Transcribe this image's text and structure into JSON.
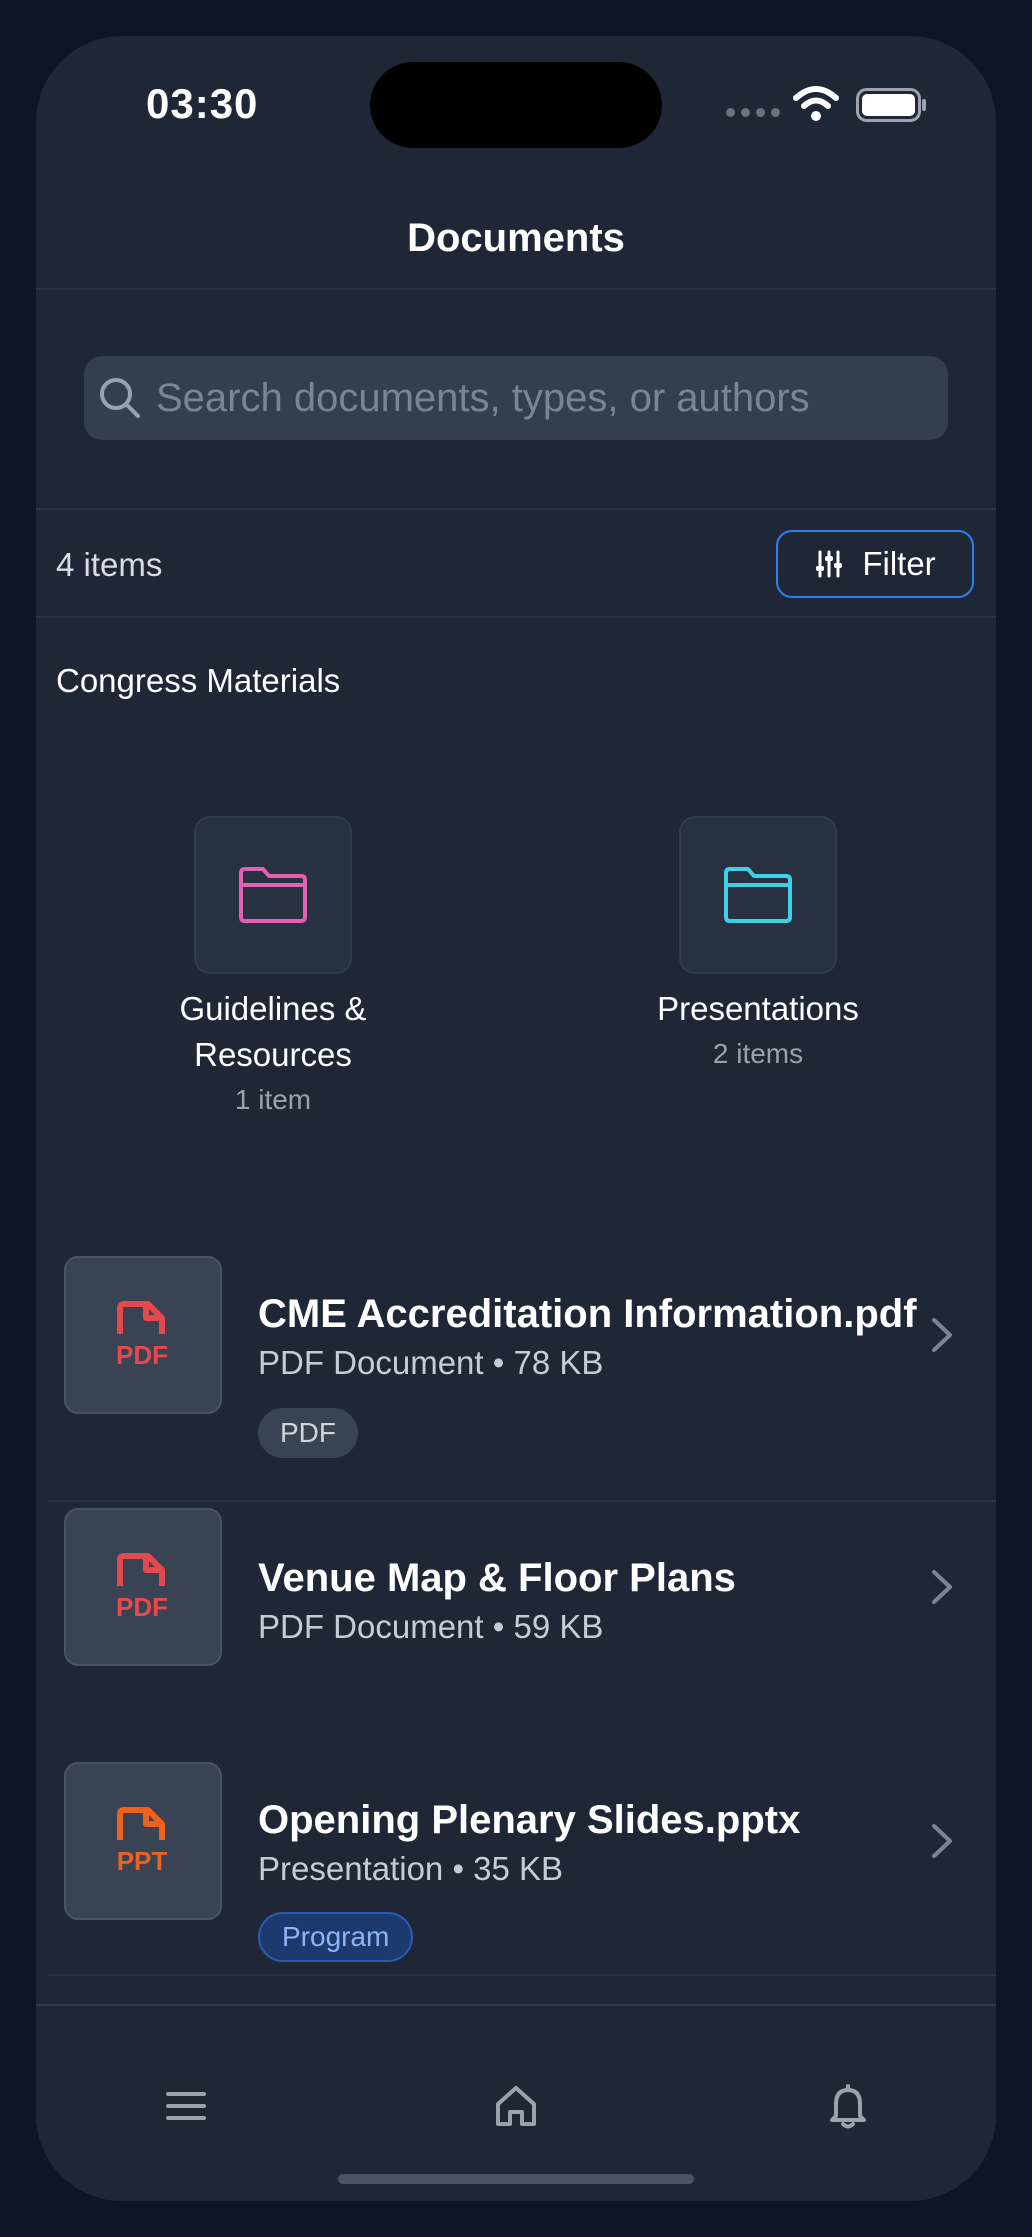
{
  "status": {
    "time": "03:30"
  },
  "header": {
    "title": "Documents"
  },
  "search": {
    "placeholder": "Search documents, types, or authors"
  },
  "list_info": {
    "count": "4 items",
    "filter_label": "Filter"
  },
  "section": {
    "title": "Congress Materials"
  },
  "folders": [
    {
      "name": "Guidelines & Resources",
      "count": "1 item",
      "color": "#e45fad"
    },
    {
      "name": "Presentations",
      "count": "2 items",
      "color": "#3fd0e6"
    }
  ],
  "documents": [
    {
      "title": "CME Accreditation Information.pdf",
      "meta": "PDF Document • 78 KB",
      "tag": "PDF",
      "icon": "pdf-file-icon",
      "icon_text": "PDF",
      "icon_color": "#e5484d"
    },
    {
      "title": "Venue Map & Floor Plans",
      "meta": "PDF Document • 59 KB",
      "tag": "",
      "icon": "pdf-file-icon",
      "icon_text": "PDF",
      "icon_color": "#e5484d"
    },
    {
      "title": "Opening Plenary Slides.pptx",
      "meta": "Presentation • 35 KB",
      "tag": "Program",
      "icon": "ppt-file-icon",
      "icon_text": "PPT",
      "icon_color": "#f0601f"
    }
  ],
  "tabs": [
    {
      "name": "menu",
      "icon": "menu-icon"
    },
    {
      "name": "home",
      "icon": "home-icon"
    },
    {
      "name": "notifications",
      "icon": "bell-icon"
    }
  ]
}
